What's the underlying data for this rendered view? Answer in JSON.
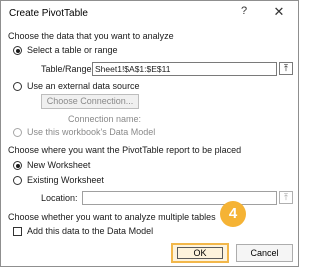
{
  "dialog": {
    "title": "Create PivotTable",
    "help_label": "?",
    "close_label": "✕"
  },
  "section1": {
    "heading": "Choose the data that you want to analyze",
    "option_select_range": "Select a table or range",
    "table_range_label": "Table/Range:",
    "table_range_value": "Sheet1!$A$1:$E$11",
    "option_external": "Use an external data source",
    "choose_connection_label": "Choose Connection...",
    "connection_name_label": "Connection name:",
    "option_data_model": "Use this workbook's Data Model"
  },
  "section2": {
    "heading": "Choose where you want the PivotTable report to be placed",
    "option_new_worksheet": "New Worksheet",
    "option_existing_worksheet": "Existing Worksheet",
    "location_label": "Location:",
    "location_value": ""
  },
  "section3": {
    "heading": "Choose whether you want to analyze multiple tables",
    "add_data_model_label": "Add this data to the Data Model"
  },
  "buttons": {
    "ok_label": "OK",
    "cancel_label": "Cancel"
  },
  "annotation": {
    "step_number": "4",
    "color": "#f5b335"
  },
  "icons": {
    "ref_button_icon": "collapse-dialog-icon",
    "ref_glyph": "⤒"
  }
}
